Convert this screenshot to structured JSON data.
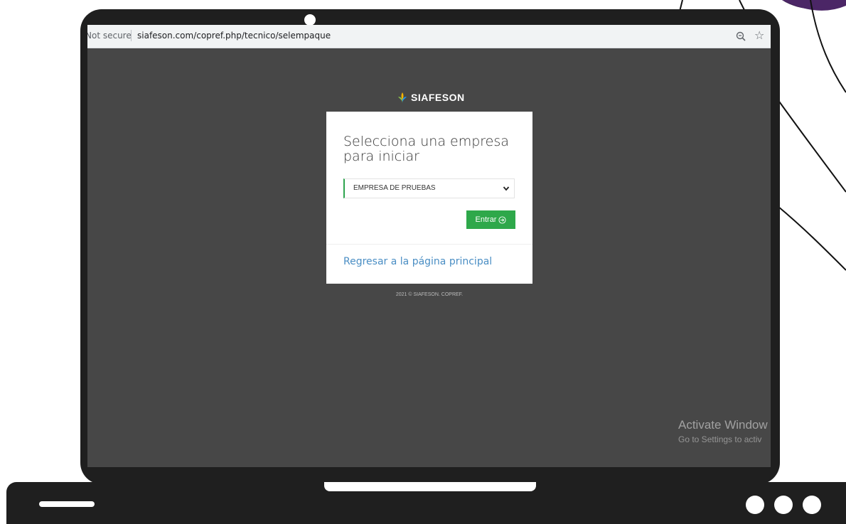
{
  "browser": {
    "security_label": "Not secure",
    "url": "siafeson.com/copref.php/tecnico/selempaque"
  },
  "brand": {
    "name": "SIAFESON"
  },
  "card": {
    "title": "Selecciona una empresa para iniciar",
    "company_select": {
      "selected": "EMPRESA DE PRUEBAS",
      "options": [
        "EMPRESA DE PRUEBAS"
      ]
    },
    "enter_label": "Entrar",
    "back_link": "Regresar a la página principal"
  },
  "footer": {
    "copyright": "2021 © SIAFESON. COPREF."
  },
  "watermark": {
    "title": "Activate Window",
    "subtitle": "Go to Settings to activ"
  },
  "colors": {
    "accent_green": "#2ea84a",
    "link_blue": "#4a8ec4",
    "screen_background": "#474747",
    "laptop_body": "#1f1f1f"
  },
  "icons": [
    "zoom-icon",
    "star-icon",
    "siafeson-logo-icon",
    "chevron-down-icon",
    "arrow-circle-right-icon"
  ]
}
